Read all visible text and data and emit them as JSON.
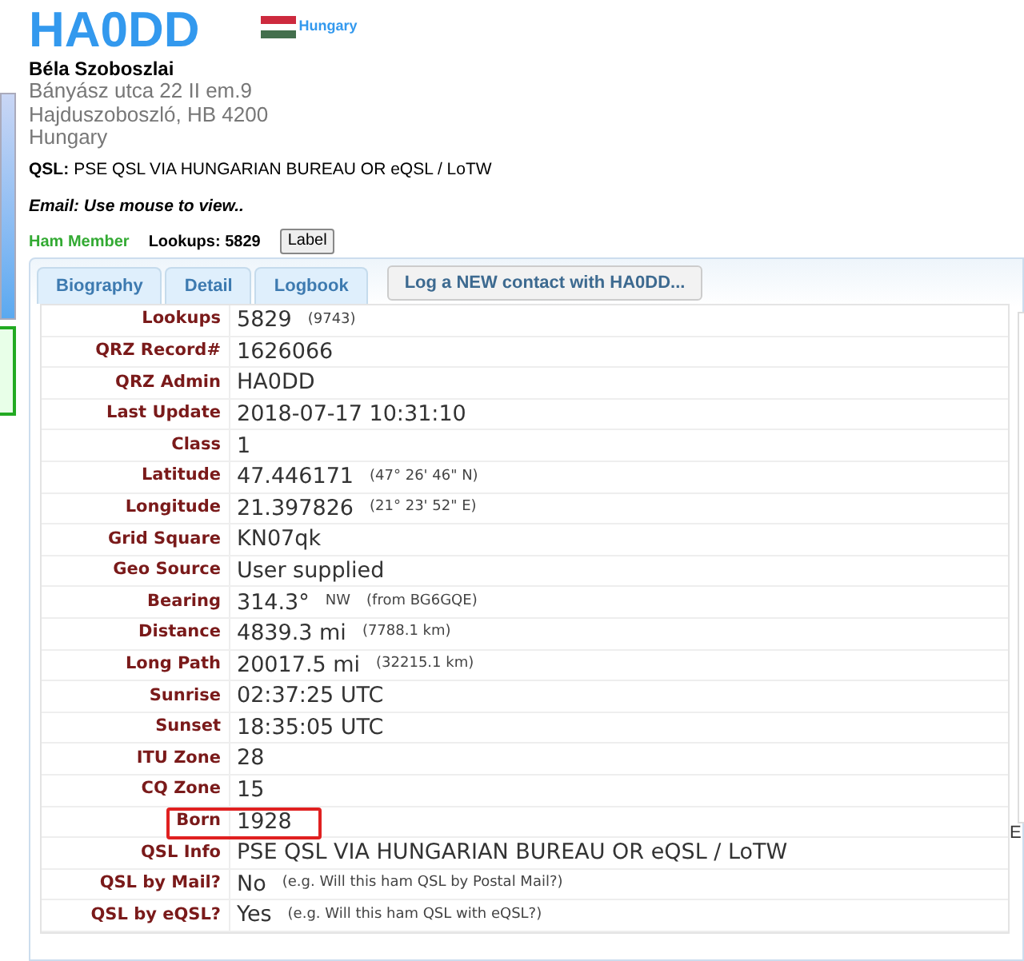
{
  "callsign": "HA0DD",
  "country": "Hungary",
  "name": "Béla Szoboszlai",
  "address": [
    "Bányász utca 22 II em.9",
    "Hajduszoboszló, HB 4200",
    "Hungary"
  ],
  "qsl": {
    "label": "QSL:",
    "text": "PSE QSL VIA HUNGARIAN BUREAU OR eQSL / LoTW"
  },
  "email": "Email: Use mouse to view..",
  "member": "Ham Member",
  "lookups": "Lookups: 5829",
  "label_button": "Label",
  "tabs": [
    {
      "label": "Biography",
      "selected": false
    },
    {
      "label": "Detail",
      "selected": false
    },
    {
      "label": "Logbook",
      "selected": false
    }
  ],
  "log_button": "Log a NEW contact with HA0DD...",
  "rows": [
    {
      "label": "Lookups",
      "value": "5829",
      "notes": [
        "(9743)"
      ],
      "highlighted": false
    },
    {
      "label": "QRZ Record#",
      "value": "1626066",
      "highlighted": false
    },
    {
      "label": "QRZ Admin",
      "value": "HA0DD",
      "highlighted": false
    },
    {
      "label": "Last Update",
      "value": "2018-07-17 10:31:10",
      "highlighted": false
    },
    {
      "label": "Class",
      "value": "1",
      "highlighted": false
    },
    {
      "label": "Latitude",
      "value": "47.446171",
      "notes": [
        "(47° 26' 46\" N)"
      ],
      "highlighted": false
    },
    {
      "label": "Longitude",
      "value": "21.397826",
      "notes": [
        "(21° 23' 52\" E)"
      ],
      "highlighted": false
    },
    {
      "label": "Grid Square",
      "value": "KN07qk",
      "highlighted": false
    },
    {
      "label": "Geo Source",
      "value": "User supplied",
      "highlighted": false
    },
    {
      "label": "Bearing",
      "value": "314.3°",
      "notes": [
        "NW",
        "(from BG6GQE)"
      ],
      "highlighted": false
    },
    {
      "label": "Distance",
      "value": "4839.3 mi",
      "notes": [
        "(7788.1 km)"
      ],
      "highlighted": false
    },
    {
      "label": "Long Path",
      "value": "20017.5 mi",
      "notes": [
        "(32215.1 km)"
      ],
      "highlighted": false
    },
    {
      "label": "Sunrise",
      "value": "02:37:25 UTC",
      "highlighted": false
    },
    {
      "label": "Sunset",
      "value": "18:35:05 UTC",
      "highlighted": false
    },
    {
      "label": "ITU Zone",
      "value": "28",
      "highlighted": false
    },
    {
      "label": "CQ Zone",
      "value": "15",
      "highlighted": false
    },
    {
      "label": "Born",
      "value": "1928",
      "highlighted": true
    },
    {
      "label": "QSL Info",
      "value": "PSE QSL VIA HUNGARIAN BUREAU OR eQSL / LoTW",
      "highlighted": false
    },
    {
      "label": "QSL by Mail?",
      "value": "No",
      "notes": [
        "(e.g. Will this ham QSL by Postal Mail?)"
      ],
      "highlighted": false
    },
    {
      "label": "QSL by eQSL?",
      "value": "Yes",
      "notes": [
        "(e.g. Will this ham QSL with eQSL?)"
      ],
      "highlighted": false
    }
  ],
  "side_fragment": "E"
}
